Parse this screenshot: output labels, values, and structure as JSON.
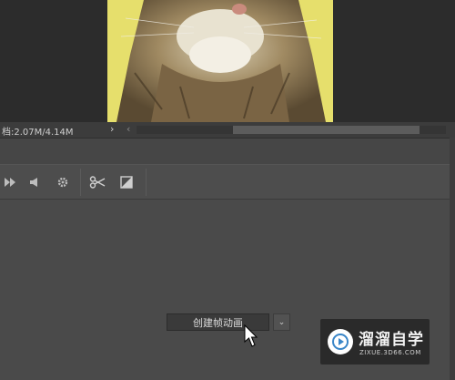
{
  "status_bar": {
    "doc_size": "档:2.07M/4.14M",
    "arrow": "›",
    "scroll_left": "‹"
  },
  "toolbar": {
    "icons": [
      "play-next-icon",
      "audio-icon",
      "gear-icon",
      "scissors-icon",
      "transition-icon"
    ]
  },
  "timeline": {
    "create_button_label": "创建帧动画",
    "dropdown_arrow": "⌄"
  },
  "watermark": {
    "title": "溜溜自学",
    "url": "ZIXUE.3D66.COM"
  },
  "colors": {
    "panel_bg": "#4a4a4a",
    "canvas_bg": "#2c2c2c",
    "logo_accent": "#3a86c8"
  }
}
